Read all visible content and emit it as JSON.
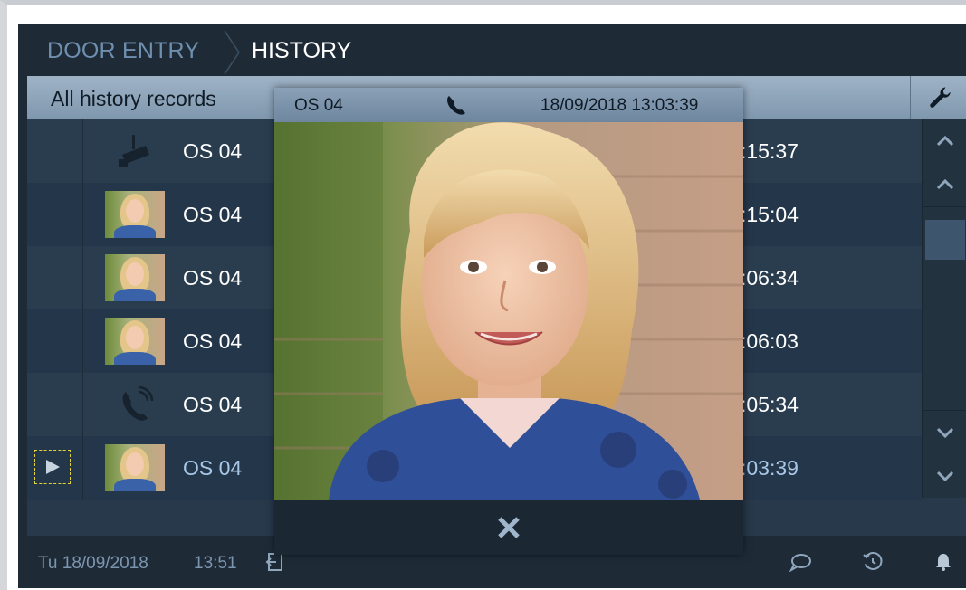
{
  "header": {
    "breadcrumb_parent": "DOOR ENTRY",
    "breadcrumb_current": "HISTORY"
  },
  "toolbar": {
    "filter_label": "All history records",
    "settings_icon": "wrench-icon"
  },
  "records": [
    {
      "type": "surveillance",
      "icon": "camera-icon",
      "name": "OS 04",
      "time_fragment": ":15:37",
      "selected": false
    },
    {
      "type": "snapshot",
      "icon": "snapshot-thumbnail",
      "name": "OS 04",
      "time_fragment": ":15:04",
      "selected": false
    },
    {
      "type": "snapshot",
      "icon": "snapshot-thumbnail",
      "name": "OS 04",
      "time_fragment": ":06:34",
      "selected": false
    },
    {
      "type": "snapshot",
      "icon": "snapshot-thumbnail",
      "name": "OS 04",
      "time_fragment": ":06:03",
      "selected": false
    },
    {
      "type": "call",
      "icon": "incoming-call-icon",
      "name": "OS 04",
      "time_fragment": ":05:34",
      "selected": false
    },
    {
      "type": "snapshot",
      "icon": "snapshot-thumbnail",
      "name": "OS 04",
      "time_fragment": ":03:39",
      "selected": true,
      "play_icon": "play-icon"
    }
  ],
  "popup": {
    "name": "OS 04",
    "call_icon": "phone-icon",
    "datetime": "18/09/2018 13:03:39",
    "close_icon": "close-icon"
  },
  "statusbar": {
    "date": "Tu 18/09/2018",
    "time": "13:51",
    "icons": [
      "logout-icon",
      "message-icon",
      "history-icon",
      "bell-icon"
    ]
  },
  "colors": {
    "background": "#1e2b37",
    "accent_text": "#6f8fb0",
    "header_gradient_top": "#9fb3c7",
    "selection": "#e4d33c"
  }
}
